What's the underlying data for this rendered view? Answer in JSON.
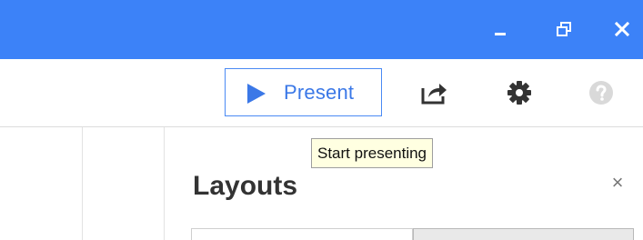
{
  "window": {
    "titlebar_color": "#3c82f8",
    "controls": {
      "minimize_icon": "minimize-icon",
      "restore_icon": "restore-icon",
      "close_icon": "close-icon"
    }
  },
  "toolbar": {
    "present_label": "Present",
    "present_color": "#3b78e7",
    "play_icon": "play-icon",
    "share_icon": "share-icon",
    "settings_icon": "gear-icon",
    "help_icon": "help-icon"
  },
  "tooltip": {
    "text": "Start presenting"
  },
  "panel": {
    "title": "Layouts",
    "close_symbol": "×"
  }
}
